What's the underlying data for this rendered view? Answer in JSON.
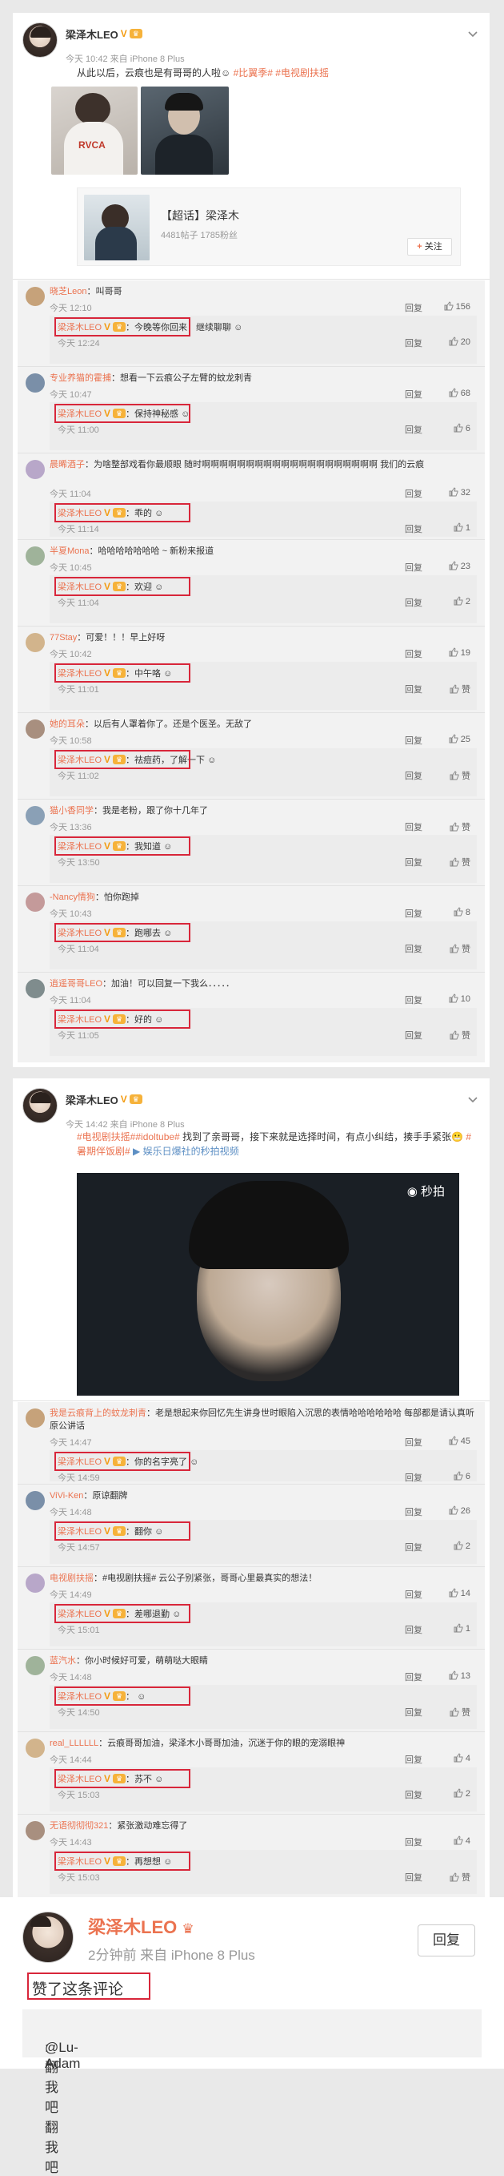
{
  "post1": {
    "name": "梁泽木LEO",
    "meta": "今天 10:42 来自 iPhone 8 Plus",
    "text_plain": "从此以后，云痕也是有哥哥的人啦",
    "tags": "#比翼季# #电视剧扶摇",
    "super": {
      "title": "【超话】梁泽木",
      "sub": "4481帖子 1785粉丝",
      "follow": "关注"
    }
  },
  "post1_comments": [
    {
      "user": "晓芝Leon",
      "text": "：叫哥哥",
      "time": "今天 12:10",
      "reply": "回复",
      "likes": "156",
      "r_user": "梁泽木LEO",
      "r_text": "：今晚等你回来！继续聊聊",
      "r_time": "今天 12:24",
      "r_likes": "20"
    },
    {
      "user": "专业养猫的霍捕",
      "text": "：想看一下云痕公子左臂的蚊龙刺青",
      "time": "今天 10:47",
      "reply": "回复",
      "likes": "68",
      "r_user": "梁泽木LEO",
      "r_text": "：保持神秘感",
      "r_time": "今天 11:00",
      "r_likes": "6"
    },
    {
      "user": "晨晞酒子",
      "text": "：为啥整部戏看你最顺眼 随时啊啊啊啊啊啊啊啊啊啊啊啊啊啊啊啊啊啊啊啊 我们的云痕",
      "time": "今天 11:04",
      "reply": "回复",
      "likes": "32",
      "r_user": "梁泽木LEO",
      "r_text": "：乖的",
      "r_time": "今天 11:14",
      "r_likes": "1"
    },
    {
      "user": "半夏Mona",
      "text": "：哈哈哈哈哈哈哈 ~ 新粉来报道",
      "time": "今天 10:45",
      "reply": "回复",
      "likes": "23",
      "r_user": "梁泽木LEO",
      "r_text": "：欢迎",
      "r_time": "今天 11:04",
      "r_likes": "2"
    },
    {
      "user": "77Stay",
      "text": "：可爱！！！早上好呀",
      "time": "今天 10:42",
      "reply": "回复",
      "likes": "19",
      "r_user": "梁泽木LEO",
      "r_text": "：中午咯",
      "r_time": "今天 11:01",
      "r_likes": "赞"
    },
    {
      "user": "她的耳朵",
      "text": "：以后有人罩着你了。还是个医圣。无敌了",
      "time": "今天 10:58",
      "reply": "回复",
      "likes": "25",
      "r_user": "梁泽木LEO",
      "r_text": "：祛痘药，了解一下",
      "r_time": "今天 11:02",
      "r_likes": "赞"
    },
    {
      "user": "猫小香同学",
      "text": "：我是老粉，跟了你十几年了",
      "time": "今天 13:36",
      "reply": "回复",
      "likes": "赞",
      "r_user": "梁泽木LEO",
      "r_text": "：我知道",
      "r_time": "今天 13:50",
      "r_likes": "赞"
    },
    {
      "user": "-Nancy情狗",
      "text": "：怕你跑掉",
      "time": "今天 10:43",
      "reply": "回复",
      "likes": "8",
      "r_user": "梁泽木LEO",
      "r_text": "：跑哪去",
      "r_time": "今天 11:04",
      "r_likes": "赞"
    },
    {
      "user": "逍遥哥哥LEO",
      "text": "：加油！可以回复一下我么．．．．．",
      "time": "今天 11:04",
      "reply": "回复",
      "likes": "10",
      "r_user": "梁泽木LEO",
      "r_text": "：好的",
      "r_time": "今天 11:05",
      "r_likes": "赞"
    }
  ],
  "post2": {
    "name": "梁泽木LEO",
    "meta": "今天 14:42 来自 iPhone 8 Plus",
    "text_a": "#电视剧扶摇##idoltube#",
    "text_b": " 找到了亲哥哥，接下来就是选择时间，有点小纠结，揍手手紧张",
    "text_c": "#暑期伴饭剧#",
    "link": "娱乐日爆社的秒拍视频",
    "watermark": "秒拍"
  },
  "post2_comments": [
    {
      "user": "我是云痕背上的蚊龙刺青",
      "text": "：老是想起来你回忆先生讲身世时眼陷入沉思的表情哈哈哈哈哈哈 每部都是请认真听原公讲话",
      "time": "今天 14:47",
      "reply": "回复",
      "likes": "45",
      "r_user": "梁泽木LEO",
      "r_text": "：你的名字亮了",
      "r_time": "今天 14:59",
      "r_likes": "6"
    },
    {
      "user": "ViVi-Ken",
      "text": "：原谅翻牌",
      "time": "今天 14:48",
      "reply": "回复",
      "likes": "26",
      "r_user": "梁泽木LEO",
      "r_text": "：翻你",
      "r_time": "今天 14:57",
      "r_likes": "2"
    },
    {
      "user": "电视剧扶摇",
      "text": "：#电视剧扶摇# 云公子别紧张，哥哥心里最真实的想法！",
      "time": "今天 14:49",
      "reply": "回复",
      "likes": "14",
      "r_user": "梁泽木LEO",
      "r_text": "：差哪退勤",
      "r_time": "今天 15:01",
      "r_likes": "1"
    },
    {
      "user": "蓝汽水",
      "text": "：你小时候好可爱，萌萌哒大眼睛",
      "time": "今天 14:48",
      "reply": "回复",
      "likes": "13",
      "r_user": "梁泽木LEO",
      "r_text": "：",
      "r_time": "今天 14:50",
      "r_likes": "赞"
    },
    {
      "user": "real_LLLLLL",
      "text": "：云痕哥哥加油，梁泽木小哥哥加油，沉迷于你的眼的宠溺眼神",
      "time": "今天 14:44",
      "reply": "回复",
      "likes": "4",
      "r_user": "梁泽木LEO",
      "r_text": "：苏不",
      "r_time": "今天 15:03",
      "r_likes": "2"
    },
    {
      "user": "无语彻彻彻321",
      "text": "：紧张激动难忘得了",
      "time": "今天 14:43",
      "reply": "回复",
      "likes": "4",
      "r_user": "梁泽木LEO",
      "r_text": "：再想想",
      "r_time": "今天 15:03",
      "r_likes": "赞"
    }
  ],
  "notification": {
    "name": "梁泽木LEO",
    "meta": "2分钟前 来自 iPhone 8 Plus",
    "reply": "回复",
    "text": "赞了这条评论",
    "quote_user": "@Lu-Adam",
    "quote_text": ": 翻我吧翻我吧"
  },
  "colors": {
    "accent": "#eb7350",
    "red_box": "#d8263a"
  }
}
